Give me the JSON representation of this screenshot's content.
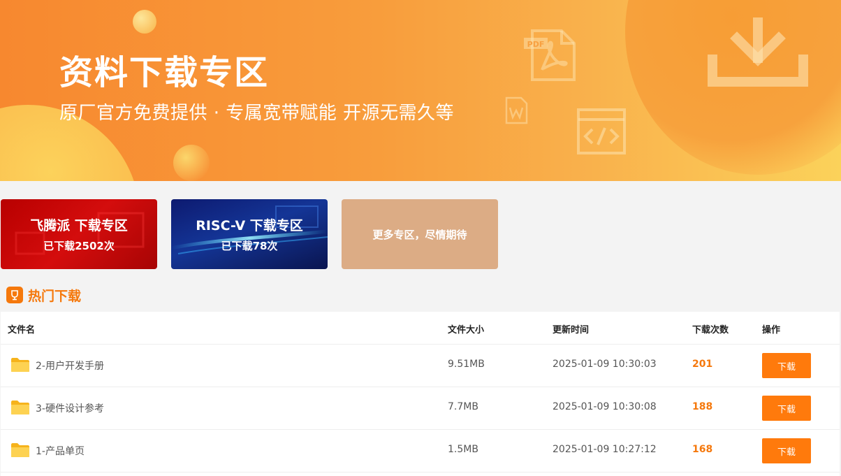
{
  "banner": {
    "title": "资料下载专区",
    "subtitle": "原厂官方免费提供 · 专属宽带赋能 开源无需久等"
  },
  "zones": [
    {
      "title": "飞腾派 下载专区",
      "count": "已下载2502次"
    },
    {
      "title": "RISC-V 下载专区",
      "count": "已下载78次"
    },
    {
      "title": "更多专区，尽情期待"
    }
  ],
  "hot": {
    "title": "热门下载",
    "columns": [
      "文件名",
      "文件大小",
      "更新时间",
      "下载次数",
      "操作"
    ],
    "rows": [
      {
        "name": "2-用户开发手册",
        "size": "9.51MB",
        "time": "2025-01-09 10:30:03",
        "count": "201",
        "action": "下载"
      },
      {
        "name": "3-硬件设计参考",
        "size": "7.7MB",
        "time": "2025-01-09 10:30:08",
        "count": "188",
        "action": "下载"
      },
      {
        "name": "1-产品单页",
        "size": "1.5MB",
        "time": "2025-01-09 10:27:12",
        "count": "168",
        "action": "下载"
      }
    ]
  },
  "colors": {
    "accent": "#f5780c",
    "button": "#ff7a0c",
    "banner_start": "#f7882f",
    "banner_end": "#fbd25a"
  },
  "icons": {
    "hot": "trophy-icon",
    "file": "folder-icon",
    "banner": [
      "download-icon",
      "pdf-file-icon",
      "word-file-icon",
      "code-file-icon"
    ]
  }
}
